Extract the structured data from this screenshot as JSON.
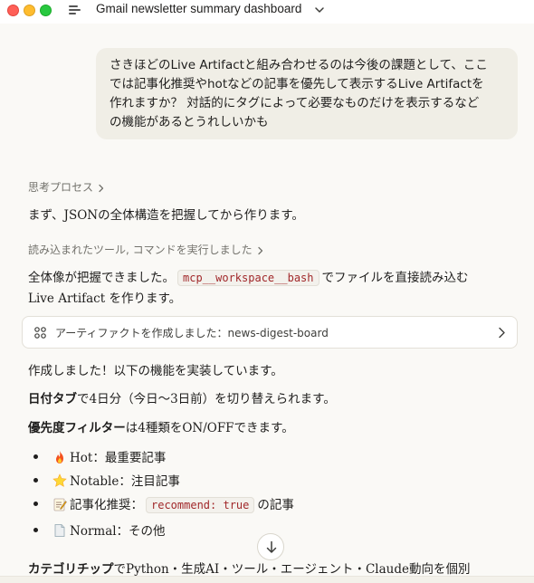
{
  "window": {
    "title": "Gmail newsletter summary dashboard"
  },
  "user_message": {
    "lines": [
      "さきほどのLive Artifactと組み合わせるのは今後の課題として、ここ",
      "では記事化推奨やhotなどの記事を優先して表示するLive Artifactを",
      "作れますか？ 対話的にタグによって必要なものだけを表示するなど",
      "の機能があるとうれしいかも"
    ]
  },
  "assistant": {
    "thinking_label": "思考プロセス",
    "line1": "まず、JSONの全体構造を把握してから作ります。",
    "tools_label": "読み込まれたツール, コマンドを実行しました",
    "line2_pre": "全体像が把握できました。",
    "line2_code": "mcp__workspace__bash",
    "line2_post": "でファイルを直接読み込む",
    "line3": "Live Artifact を作ります。",
    "artifact": {
      "label": "アーティファクトを作成しました：news-digest-board",
      "icon": "artifact-icon"
    },
    "line4": "作成しました！以下の機能を実装しています。",
    "date_tab_bold": "日付タブ",
    "date_tab_rest": "で4日分（今日〜3日前）を切り替えられます。",
    "priority_bold": "優先度フィルター",
    "priority_rest": "は4種類をON/OFFできます。",
    "bullets": [
      {
        "icon": "fire-icon",
        "text": "Hot：最重要記事"
      },
      {
        "icon": "star-icon",
        "text": "Notable：注目記事"
      },
      {
        "icon": "memo-icon",
        "pre": "記事化推奨：",
        "code": "recommend: true",
        "post": "の記事"
      },
      {
        "icon": "page-icon",
        "text": "Normal：その他"
      }
    ],
    "category_bold": "カテゴリチップ",
    "category_rest": "でPython・生成AI・ツール・エージェント・Claude動向を個別"
  },
  "colors": {
    "background": "#faf9f6",
    "bubble": "#f0eee6",
    "code_text": "#a1282a",
    "muted_text": "#73726c"
  }
}
